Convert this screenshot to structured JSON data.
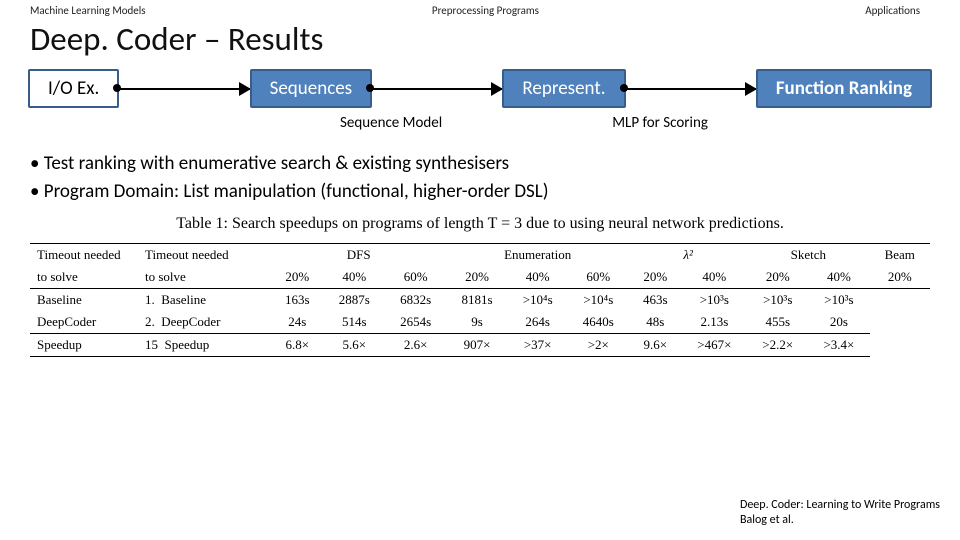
{
  "topLabels": {
    "left": "Machine Learning Models",
    "center": "Preprocessing Programs",
    "right": "Applications"
  },
  "title": "Deep. Coder – Results",
  "flow": {
    "n1": "I/O Ex.",
    "n2": "Sequences",
    "n3": "Represent.",
    "n4": "Function Ranking",
    "sub1": "Sequence Model",
    "sub2": "MLP for Scoring"
  },
  "bullets": {
    "b1": "Test ranking with enumerative search & existing synthesisers",
    "b2": "Program Domain: List manipulation (functional, higher-order DSL)"
  },
  "table": {
    "caption": "Table 1: Search speedups on programs of length T = 3 due to using neural network predictions.",
    "leftColHead1": "Timeout needed",
    "leftColHead2": "to solve",
    "leftRows": [
      "Baseline",
      "DeepCoder",
      "Speedup"
    ],
    "mainHead1": "Timeout needed",
    "mainHead2": "to solve",
    "groups": [
      "DFS",
      "Enumeration",
      "λ²",
      "Sketch",
      "Beam"
    ],
    "subHeads": [
      "20%",
      "40%",
      "60%",
      "20%",
      "40%",
      "60%",
      "20%",
      "40%",
      "20%",
      "40%",
      "20%"
    ],
    "sub2": [
      "1.",
      "2.",
      "15"
    ],
    "rows": {
      "baseline": [
        "Baseline",
        "163s",
        "2887s",
        "6832s",
        "8181s",
        ">10⁴s",
        ">10⁴s",
        "463s",
        ">10³s",
        ">10³s",
        ">10³s"
      ],
      "deepcoder": [
        "DeepCoder",
        "24s",
        "514s",
        "2654s",
        "9s",
        "264s",
        "4640s",
        "48s",
        "2.13s",
        "455s",
        "20s"
      ],
      "speedup": [
        "Speedup",
        "6.8×",
        "5.6×",
        "2.6×",
        "907×",
        ">37×",
        ">2×",
        "9.6×",
        ">467×",
        ">2.2×",
        ">3.4×"
      ]
    }
  },
  "citation": {
    "l1": "Deep. Coder: Learning to Write Programs",
    "l2": "Balog et al."
  }
}
